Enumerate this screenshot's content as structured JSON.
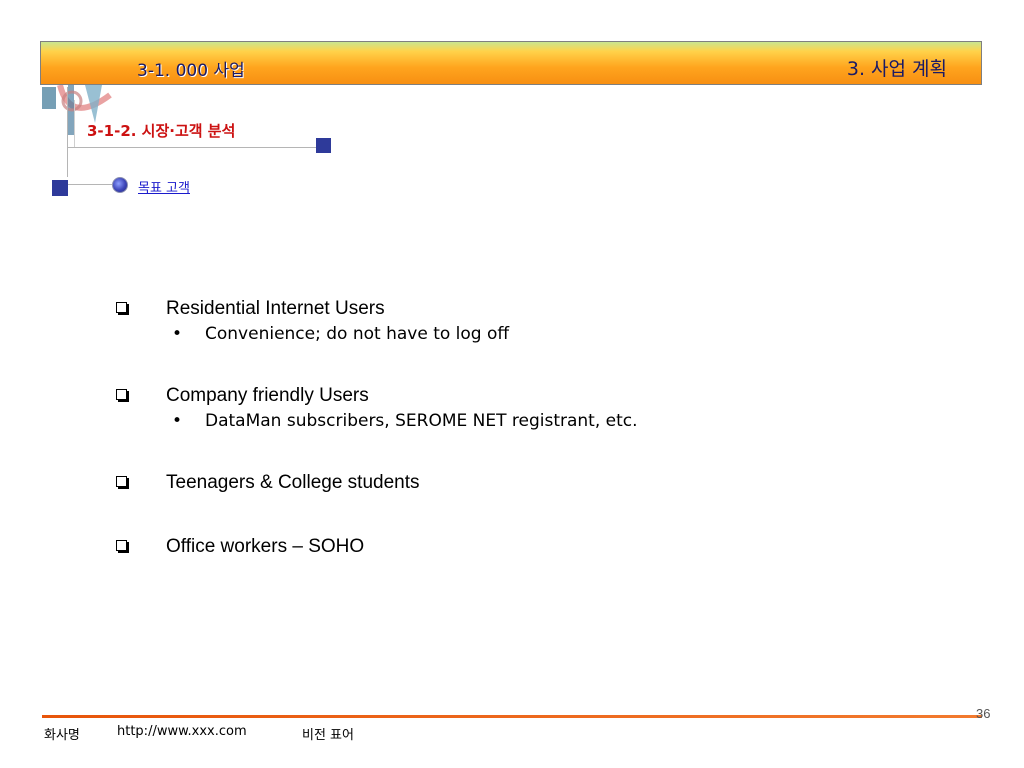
{
  "header": {
    "subtitle": "3-1. 000 사업",
    "title": "3. 사업 계획"
  },
  "section": {
    "title": "3-1-2. 시장·고객 분석",
    "link": "목표 고객 "
  },
  "items": [
    {
      "label": "Residential Internet Users",
      "sub": "Convenience; do not have to log off"
    },
    {
      "label": "Company friendly Users",
      "sub": "DataMan subscribers, SEROME NET registrant, etc."
    },
    {
      "label": "Teenagers & College students",
      "sub": ""
    },
    {
      "label": "Office workers – SOHO",
      "sub": ""
    }
  ],
  "bullet_glyph": "•",
  "footer": {
    "company": "화사명",
    "url": "http://www.xxx.com",
    "vision": "비전 표어",
    "page_number": "36"
  },
  "colors": {
    "banner_orange": "#ffa51e",
    "title_red": "#cc1111",
    "accent_blue": "#2e3a9a",
    "footer_line": "#e8550a"
  }
}
